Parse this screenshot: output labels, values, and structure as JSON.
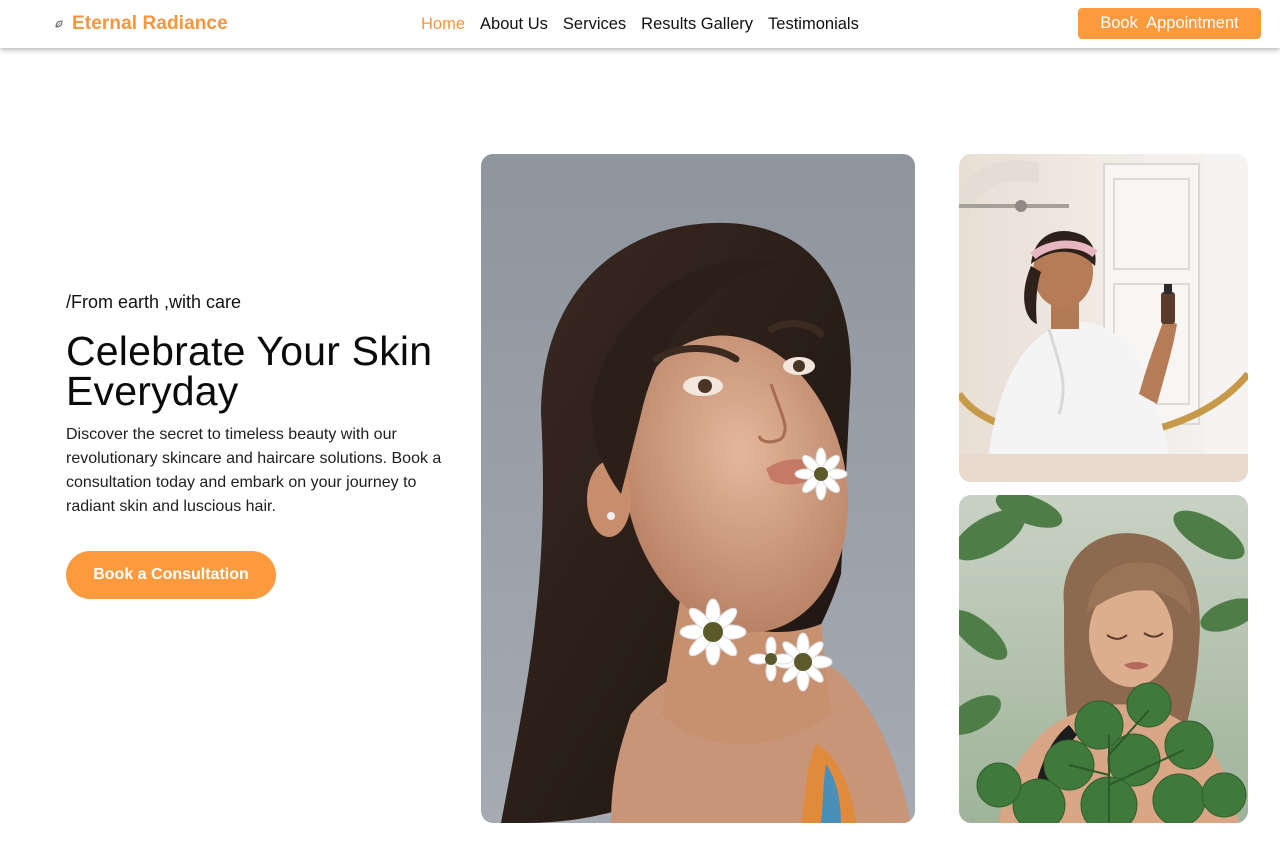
{
  "brand": {
    "name": "Eternal Radiance",
    "logo_icon": "leaf-icon",
    "accent_color": "#f7963c",
    "button_color": "#fd9a3e"
  },
  "nav": {
    "links": [
      {
        "label": "Home",
        "active": true
      },
      {
        "label": "About Us",
        "active": false
      },
      {
        "label": "Services",
        "active": false
      },
      {
        "label": "Results Gallery",
        "active": false
      },
      {
        "label": "Testimonials",
        "active": false
      }
    ],
    "book_button": "Book  Appointment"
  },
  "hero": {
    "tagline": "/From earth ,with care",
    "headline": "Celebrate Your Skin Everyday",
    "description": "Discover the secret to timeless beauty with our revolutionary skincare and haircare solutions. Book a consultation today and embark on your journey to radiant skin and luscious hair.",
    "cta_button": "Book a Consultation"
  }
}
